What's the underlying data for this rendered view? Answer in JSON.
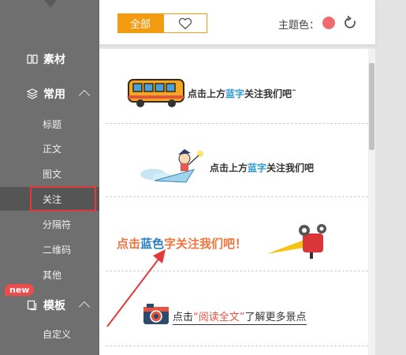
{
  "sidebar": {
    "items": [
      {
        "label": "素材"
      },
      {
        "label": "常用"
      }
    ],
    "sub_items": [
      {
        "label": "标题"
      },
      {
        "label": "正文"
      },
      {
        "label": "图文"
      },
      {
        "label": "关注"
      },
      {
        "label": "分隔符"
      },
      {
        "label": "二维码"
      },
      {
        "label": "其他"
      }
    ],
    "template": {
      "label": "模板",
      "badge": "new"
    },
    "custom": {
      "label": "自定义"
    }
  },
  "toolbar": {
    "all_label": "全部",
    "theme_label": "主题色：",
    "theme_color": "#f06b6b",
    "accent": "#f39c12"
  },
  "cards": [
    {
      "pre": "点击上方",
      "key": "蓝字",
      "post": "关注我们吧˜"
    },
    {
      "pre": "点击上方",
      "key": "蓝字",
      "post": "关注我们吧"
    },
    {
      "pre": "点击",
      "key": "蓝色",
      "post": "字关注我们吧！"
    },
    {
      "pre": "点击",
      "key": "“阅读全文”",
      "post": "了解更多景点"
    }
  ]
}
